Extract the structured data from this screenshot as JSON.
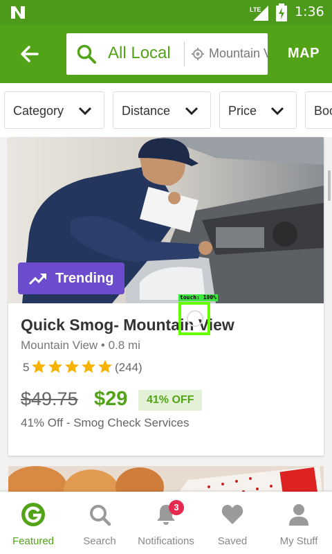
{
  "status_bar": {
    "network": "LTE",
    "time": "1:36"
  },
  "header": {
    "search_query": "All Local",
    "location": "Mountain View",
    "map_label": "MAP"
  },
  "filters": [
    {
      "label": "Category"
    },
    {
      "label": "Distance"
    },
    {
      "label": "Price"
    },
    {
      "label": "Boo"
    }
  ],
  "deal": {
    "badge": "Trending",
    "title": "Quick Smog- Mountain View",
    "location": "Mountain View • 0.8 mi",
    "rating": "5",
    "rating_count": "(244)",
    "stars": 5,
    "price_original": "$49.75",
    "price_sale": "$29",
    "discount": "41% OFF",
    "description": "41% Off - Smog Check Services"
  },
  "touch_overlay": {
    "label": "touch: 100%"
  },
  "bottom_nav": {
    "items": [
      {
        "label": "Featured",
        "icon": "groupon-g-icon"
      },
      {
        "label": "Search",
        "icon": "search-icon"
      },
      {
        "label": "Notifications",
        "icon": "bell-icon"
      },
      {
        "label": "Saved",
        "icon": "heart-icon"
      },
      {
        "label": "My Stuff",
        "icon": "person-icon"
      }
    ],
    "notification_count": "3"
  },
  "colors": {
    "brand_green": "#53a318",
    "status_green": "#4d9a1b",
    "trending_purple": "#6c4ccc",
    "star_gold": "#f5b400",
    "badge_red": "#e52a50"
  }
}
